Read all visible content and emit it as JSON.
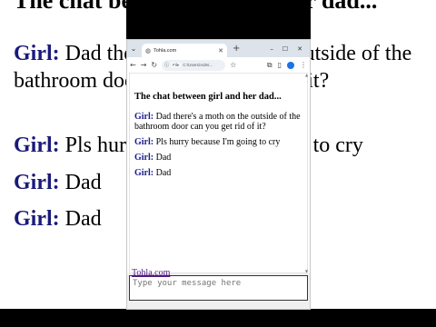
{
  "background_page": {
    "title": "The chat between girl and her dad...",
    "messages": [
      {
        "who": "Girl:",
        "text": "Dad there's a moth on the outside of the bathroom door can you get rid of it?"
      },
      {
        "who": "Girl:",
        "text": "Pls hurry because I'm going to cry"
      },
      {
        "who": "Girl:",
        "text": "Dad"
      },
      {
        "who": "Girl:",
        "text": "Dad"
      }
    ]
  },
  "browser": {
    "tab_title": "Tohla.com",
    "address_chip": "File",
    "address_url": "C:/Users/Admi...",
    "icons": {
      "tab_menu": "chevron-down-icon",
      "tab_favicon": "globe-icon",
      "tab_close": "close-icon",
      "new_tab": "plus-icon",
      "minimize": "minimize-icon",
      "maximize": "maximize-icon",
      "close_window": "close-icon",
      "back": "back-arrow-icon",
      "forward": "forward-arrow-icon",
      "reload": "reload-icon",
      "info": "info-icon",
      "bookmark": "star-icon",
      "extensions": "puzzle-icon",
      "sidebar": "sidebar-icon",
      "profile": "profile-icon",
      "menu": "kebab-menu-icon"
    }
  },
  "page": {
    "title": "The chat between girl and her dad...",
    "messages": [
      {
        "who": "Girl:",
        "text": "Dad there's a moth on the outside of the bathroom door can you get rid of it?"
      },
      {
        "who": "Girl:",
        "text": "Pls hurry because I'm going to cry"
      },
      {
        "who": "Girl:",
        "text": "Dad"
      },
      {
        "who": "Girl:",
        "text": "Dad"
      }
    ],
    "input_placeholder": "Type your message here",
    "footer_link": "Tohla.com"
  },
  "colors": {
    "sender": "#1a1a8a",
    "link": "#551a8b",
    "tabstrip": "#dde3ea"
  }
}
